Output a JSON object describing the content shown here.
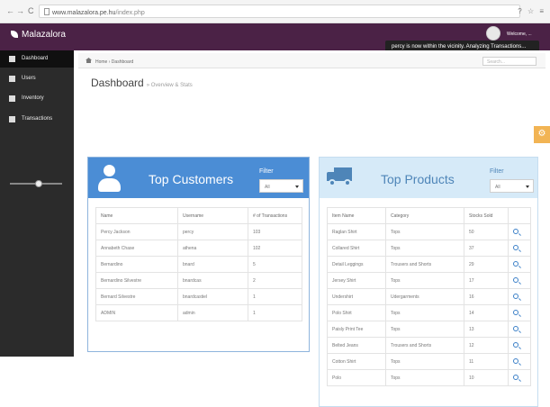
{
  "browser": {
    "url_domain": "www.malazalora.pe.hu",
    "url_path": "/index.php",
    "back_icon": "arrow-left-icon",
    "forward_icon": "arrow-right-icon",
    "reload_icon": "reload-icon"
  },
  "app": {
    "brand": "Malazalora",
    "welcome": "Welcome, ...",
    "notification": "percy is now within the vicinity. Analyzing Transactions..."
  },
  "sidebar": {
    "items": [
      {
        "label": "Dashboard",
        "icon": "dashboard-icon"
      },
      {
        "label": "Users",
        "icon": "user-icon"
      },
      {
        "label": "Inventory",
        "icon": "cart-icon"
      },
      {
        "label": "Transactions",
        "icon": "transactions-icon"
      }
    ],
    "slider_value": 0.55
  },
  "breadcrumb": {
    "home": "Home",
    "current": "Dashboard",
    "search_placeholder": "Search..."
  },
  "page": {
    "title": "Dashboard",
    "subtitle": "Overview & Stats"
  },
  "customers": {
    "title": "Top Customers",
    "filter_label": "Filter",
    "filter_value": "All",
    "headers": [
      "Name",
      "Username",
      "# of Transactions"
    ],
    "rows": [
      [
        "Percy Jackson",
        "percy",
        "103"
      ],
      [
        "Annabeth Chase",
        "athena",
        "102"
      ],
      [
        "Bernardino",
        "bnard",
        "5"
      ],
      [
        "Bernardino Silvestre",
        "bnardcas",
        "2"
      ],
      [
        "Bernard Silvestre",
        "bnardcastiel",
        "1"
      ],
      [
        "ADMIN",
        "admin",
        "1"
      ]
    ]
  },
  "products": {
    "title": "Top Products",
    "filter_label": "Filter",
    "filter_value": "All",
    "headers": [
      "Item Name",
      "Category",
      "Stocks Sold",
      ""
    ],
    "rows": [
      [
        "Raglan Shirt",
        "Tops",
        "50"
      ],
      [
        "Collared Shirt",
        "Tops",
        "37"
      ],
      [
        "Detail Leggings",
        "Trousers and Shorts",
        "29"
      ],
      [
        "Jersey Shirt",
        "Tops",
        "17"
      ],
      [
        "Undershirt",
        "Udergarments",
        "16"
      ],
      [
        "Polo Shirt",
        "Tops",
        "14"
      ],
      [
        "Paisly Print Tee",
        "Tops",
        "13"
      ],
      [
        "Belted Jeans",
        "Trousers and Shorts",
        "12"
      ],
      [
        "Cotton Shirt",
        "Tops",
        "11"
      ],
      [
        "Polo",
        "Tops",
        "10"
      ]
    ]
  },
  "colors": {
    "topbar": "#4b2246",
    "sidebar": "#2b2b2b",
    "customers_header": "#4b8dd5",
    "products_header": "#d6eaf8",
    "accent": "#3a7fc7"
  }
}
